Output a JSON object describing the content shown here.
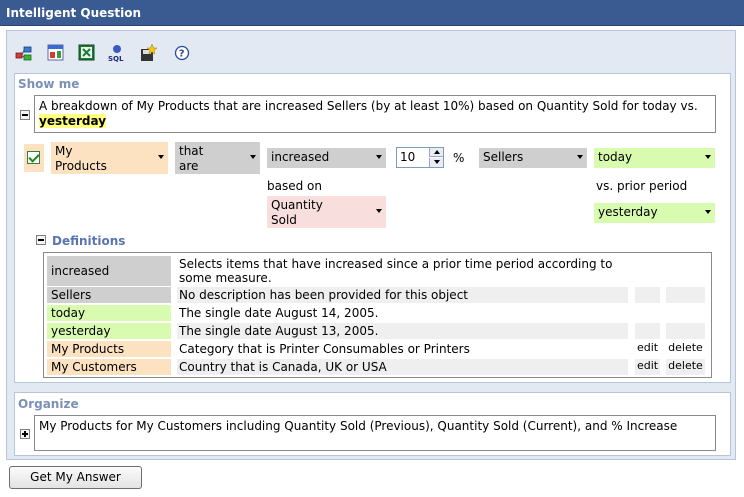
{
  "title": "Intelligent Question",
  "toolbar": {
    "icons": [
      "hierarchy-icon",
      "chart-icon",
      "excel-icon",
      "sql-icon",
      "save-favorite-icon",
      "help-icon"
    ]
  },
  "show_me": {
    "label": "Show me",
    "sentence_text": "A breakdown of My Products that are increased Sellers (by at least 10%) based on Quantity Sold for today vs.",
    "sentence_highlight": "yesterday"
  },
  "criteria": {
    "subject": "My Products",
    "relation": "that are",
    "direction": "increased",
    "amount": "10",
    "percent_sign": "%",
    "measure_type": "Sellers",
    "period": "today",
    "based_on_label": "based on",
    "based_on_value": "Quantity Sold",
    "vs_label": "vs. prior period",
    "prior_period": "yesterday"
  },
  "definitions": {
    "label": "Definitions",
    "rows": [
      {
        "term": "increased",
        "description": "Selects items that have increased since a prior time period according to some measure.",
        "edit": "",
        "delete": "",
        "color": "#cfcfcf"
      },
      {
        "term": "Sellers",
        "description": "No description has been provided for this object",
        "edit": "",
        "delete": "",
        "color": "#cfcfcf"
      },
      {
        "term": "today",
        "description": "The single date August 14, 2005.",
        "edit": "",
        "delete": "",
        "color": "#d8fbb0"
      },
      {
        "term": "yesterday",
        "description": "The single date August 13, 2005.",
        "edit": "",
        "delete": "",
        "color": "#d8fbb0"
      },
      {
        "term": "My Products",
        "description": "Category that is Printer Consumables or Printers",
        "edit": "edit",
        "delete": "delete",
        "color": "#fce2c0"
      },
      {
        "term": "My Customers",
        "description": "Country that is Canada, UK or USA",
        "edit": "edit",
        "delete": "delete",
        "color": "#fce2c0"
      }
    ]
  },
  "organize": {
    "label": "Organize",
    "sentence": "My Products for My Customers including Quantity Sold (Previous), Quantity Sold (Current), and % Increase"
  },
  "button_label": "Get My Answer"
}
